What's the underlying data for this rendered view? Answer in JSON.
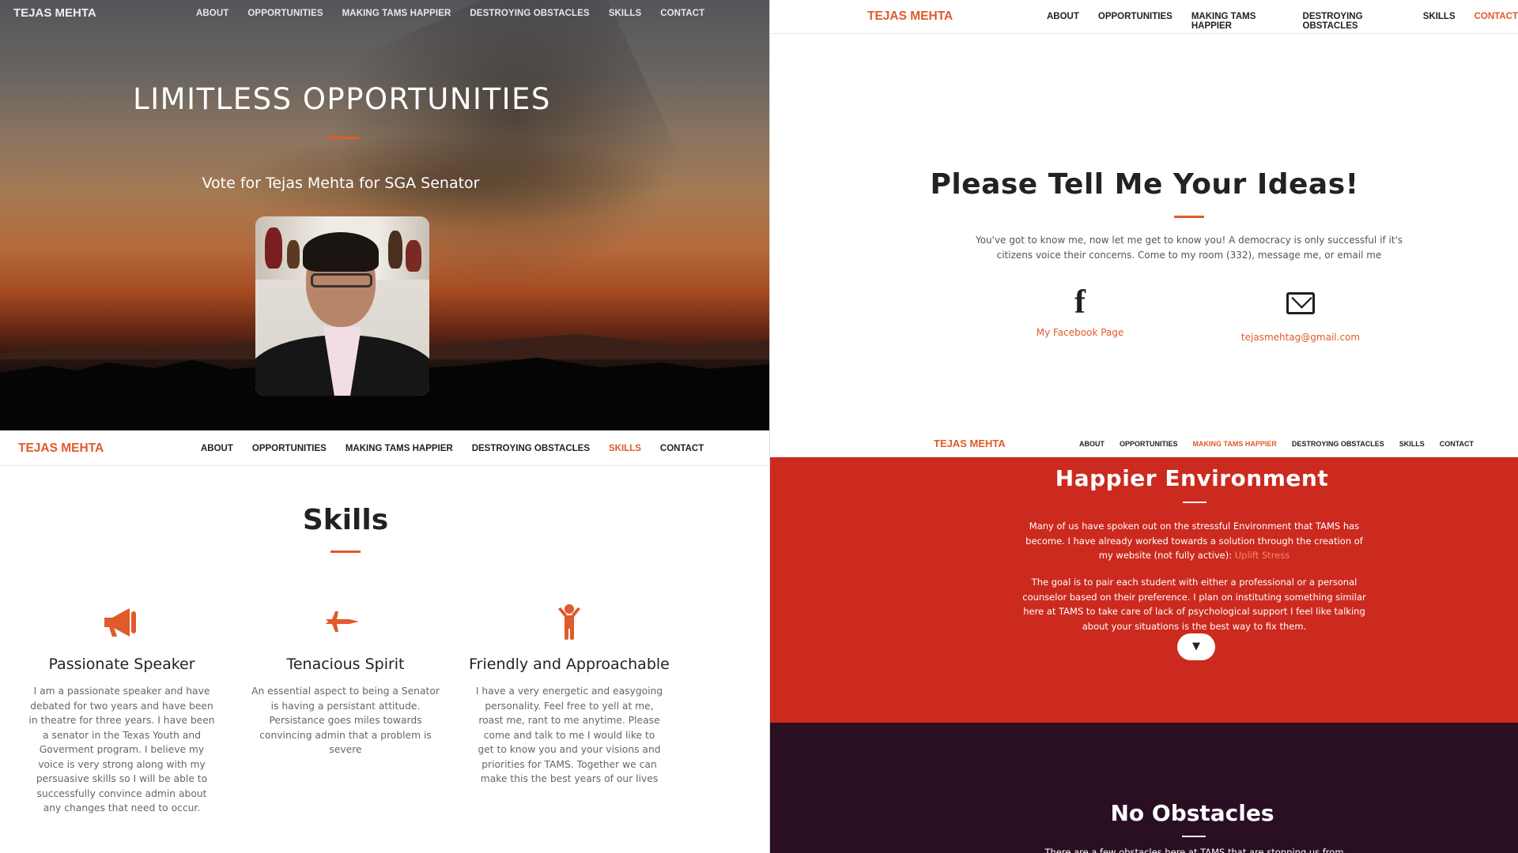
{
  "nav": {
    "brand": "TEJAS MEHTA",
    "items": [
      "ABOUT",
      "OPPORTUNITIES",
      "MAKING TAMS HAPPIER",
      "DESTROYING OBSTACLES",
      "SKILLS",
      "CONTACT"
    ]
  },
  "colors": {
    "accent": "#e05a2b",
    "red_section": "#cc2a1f",
    "dark_section": "#2a0e22"
  },
  "hero": {
    "title": "LIMITLESS OPPORTUNITIES",
    "subtitle": "Vote for Tejas Mehta for SGA Senator"
  },
  "contact": {
    "active_nav": "CONTACT",
    "title": "Please Tell Me Your Ideas!",
    "description": "You've got to know me, now let me get to know you! A democracy is only successful if it's citizens voice their concerns. Come to my room (332), message me, or email me",
    "facebook": {
      "icon": "facebook-icon",
      "label": "My Facebook Page"
    },
    "email": {
      "icon": "envelope-icon",
      "label": "tejasmehtag@gmail.com"
    }
  },
  "skills": {
    "active_nav": "SKILLS",
    "title": "Skills",
    "items": [
      {
        "icon": "megaphone-icon",
        "heading": "Passionate Speaker",
        "text": "I am a passionate speaker and have debated for two years and have been in theatre for three years. I have been a senator in the Texas Youth and Goverment program. I believe my voice is very strong along with my persuasive skills so I will be able to successfully convince admin about any changes that need to occur."
      },
      {
        "icon": "fighter-jet-icon",
        "heading": "Tenacious Spirit",
        "text": "An essential aspect to being a Senator is having a persistant attitude. Persistance goes miles towards convincing admin that a problem is severe"
      },
      {
        "icon": "child-icon",
        "heading": "Friendly and Approachable",
        "text": "I have a very energetic and easygoing personality. Feel free to yell at me, roast me, rant to me anytime. Please come and talk to me I would like to get to know you and your visions and priorities for TAMS. Together we can make this the best years of our lives"
      }
    ]
  },
  "happier": {
    "active_nav": "MAKING TAMS HAPPIER",
    "title": "Happier Environment",
    "para1_before": "Many of us have spoken out on the stressful Environment that TAMS has become. I have already worked towards a solution through the creation of my website (not fully active): ",
    "para1_link": "Uplift Stress",
    "para2": "The goal is to pair each student with either a professional or a personal counselor based on their preference. I plan on instituting something similar here at TAMS to take care of lack of psychological support I feel like talking about your situations is the best way to fix them.",
    "scroll_button": "▼"
  },
  "obstacles": {
    "title": "No Obstacles",
    "text": "There are a few obstacles here at TAMS that are stopping us from"
  }
}
